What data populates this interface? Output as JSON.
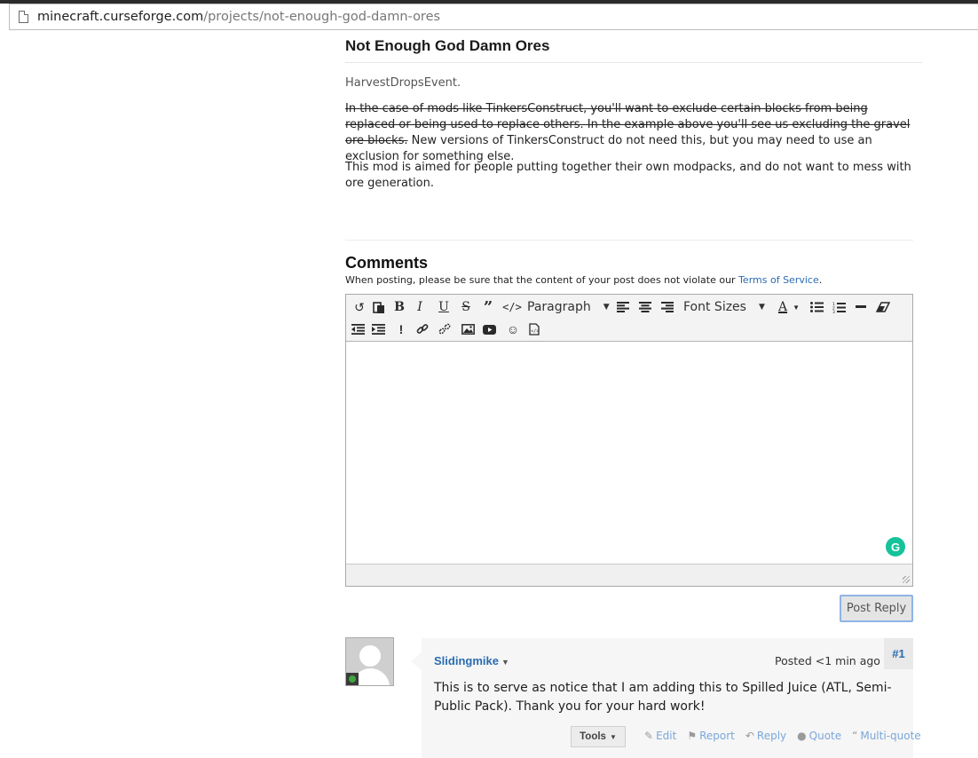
{
  "browser": {
    "url_host": "minecraft.curseforge.com",
    "url_path": "/projects/not-enough-god-damn-ores"
  },
  "project": {
    "title": "Not Enough God Damn Ores",
    "event_text": "HarvestDropsEvent.",
    "para1_struck": "In the case of mods like TinkersConstruct, you'll want to exclude certain blocks from being replaced or being used to replace others. In the example above you'll see us excluding the gravel ore blocks.",
    "para1_rest": " New versions of TinkersConstruct do not need this, but you may need to use an exclusion for something else.",
    "para2": "This mod is aimed for people putting together their own modpacks, and do not want to mess with ore generation."
  },
  "comments": {
    "title": "Comments",
    "note_prefix": "When posting, please be sure that the content of your post does not violate our ",
    "note_link": "Terms of Service",
    "note_suffix": ".",
    "editor": {
      "paragraph_select": "Paragraph",
      "font_sizes_select": "Font Sizes",
      "grammarly_badge": "G"
    },
    "post_reply_label": "Post Reply",
    "items": [
      {
        "author": "Slidingmike",
        "posted": "Posted <1 min ago",
        "number": "#1",
        "text": "This is to serve as notice that I am adding this to Spilled Juice (ATL, Semi-Public Pack). Thank you for your hard work!",
        "tools_label": "Tools",
        "actions": {
          "edit": "Edit",
          "report": "Report",
          "reply": "Reply",
          "quote": "Quote",
          "multi_quote": "Multi-quote"
        }
      }
    ]
  },
  "colors": {
    "link": "#2b6cb0",
    "action_link": "#7aa7db",
    "grammarly": "#15c39a"
  }
}
